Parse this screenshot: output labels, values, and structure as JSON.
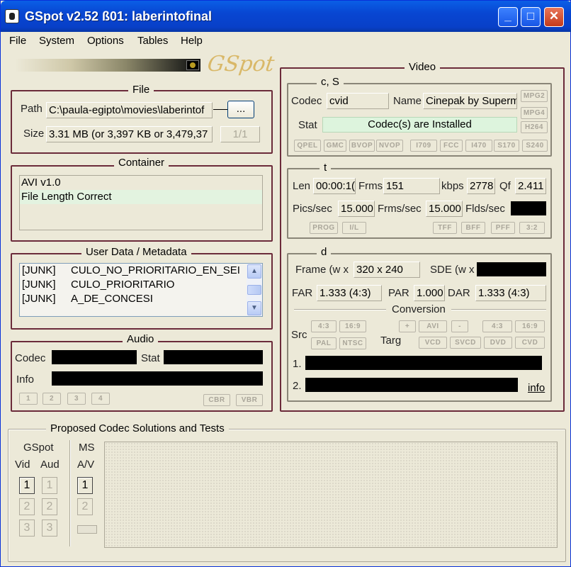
{
  "window": {
    "title": "GSpot v2.52 ß01: laberintofinal"
  },
  "menu": [
    "File",
    "System",
    "Options",
    "Tables",
    "Help"
  ],
  "logo": "GSpot",
  "file": {
    "legend": "File",
    "path_label": "Path",
    "path_value": "C:\\paula-egipto\\movies\\laberintof",
    "browse_label": "...",
    "size_label": "Size",
    "size_value": "3.31 MB (or 3,397 KB or 3,479,37",
    "page_label": "1/1"
  },
  "container": {
    "legend": "Container",
    "lines": [
      "AVI v1.0",
      "File Length Correct"
    ]
  },
  "userdata": {
    "legend": "User Data / Metadata",
    "rows": [
      {
        "tag": "[JUNK]",
        "value": "CULO_NO_PRIORITARIO_EN_SEI"
      },
      {
        "tag": "[JUNK]",
        "value": "CULO_PRIORITARIO"
      },
      {
        "tag": "[JUNK]",
        "value": "A_DE_CONCESI"
      }
    ]
  },
  "audio": {
    "legend": "Audio",
    "codec_label": "Codec",
    "stat_label": "Stat",
    "info_label": "Info",
    "streams": [
      "1",
      "2",
      "3",
      "4"
    ],
    "cbr": "CBR",
    "vbr": "VBR"
  },
  "video": {
    "legend": "Video",
    "cs": {
      "legend": "c, S",
      "codec_label": "Codec",
      "codec_value": "cvid",
      "name_label": "Name",
      "name_value": "Cinepak by Superm",
      "stat_label": "Stat",
      "stat_value": "Codec(s) are Installed",
      "side_buttons": [
        "MPG2",
        "MPG4",
        "H264"
      ],
      "flags": [
        "QPEL",
        "GMC",
        "BVOP",
        "NVOP",
        "I709",
        "FCC",
        "I470",
        "S170",
        "S240"
      ]
    },
    "t": {
      "legend": "t",
      "len_label": "Len",
      "len_value": "00:00:1(",
      "frms_label": "Frms",
      "frms_value": "151",
      "kbps_label": "kbps",
      "kbps_value": "2778",
      "qf_label": "Qf",
      "qf_value": "2.411",
      "pics_label": "Pics/sec",
      "pics_value": "15.000",
      "frms_sec_label": "Frms/sec",
      "frms_sec_value": "15.000",
      "flds_label": "Flds/sec",
      "flags": [
        "PROG",
        "I/L",
        "TFF",
        "BFF",
        "PFF",
        "3:2"
      ]
    },
    "d": {
      "legend": "d",
      "frame_label": "Frame (w x",
      "frame_value": "320 x 240",
      "sde_label": "SDE (w x",
      "far_label": "FAR",
      "far_value": "1.333 (4:3)",
      "par_label": "PAR",
      "par_value": "1.000",
      "dar_label": "DAR",
      "dar_value": "1.333 (4:3)",
      "conversion_label": "Conversion",
      "src_label": "Src",
      "targ_label": "Targ",
      "conv_top": [
        "+",
        "AVI",
        "-"
      ],
      "ratio_right": [
        "4:3",
        "16:9"
      ],
      "src_ratio": [
        "4:3",
        "16:9"
      ],
      "src_std": [
        "PAL",
        "NTSC"
      ],
      "targ_btns": [
        "VCD",
        "SVCD",
        "DVD",
        "CVD"
      ],
      "out1": "1.",
      "out2": "2.",
      "info_link": "info"
    }
  },
  "proposed": {
    "legend": "Proposed Codec Solutions and Tests",
    "gspot_label": "GSpot",
    "ms_label": "MS",
    "vid_label": "Vid",
    "aud_label": "Aud",
    "av_label": "A/V",
    "vid_nums": [
      "1",
      "2",
      "3"
    ],
    "aud_nums": [
      "1",
      "2",
      "3"
    ],
    "ms_nums": [
      "1",
      "2"
    ]
  }
}
